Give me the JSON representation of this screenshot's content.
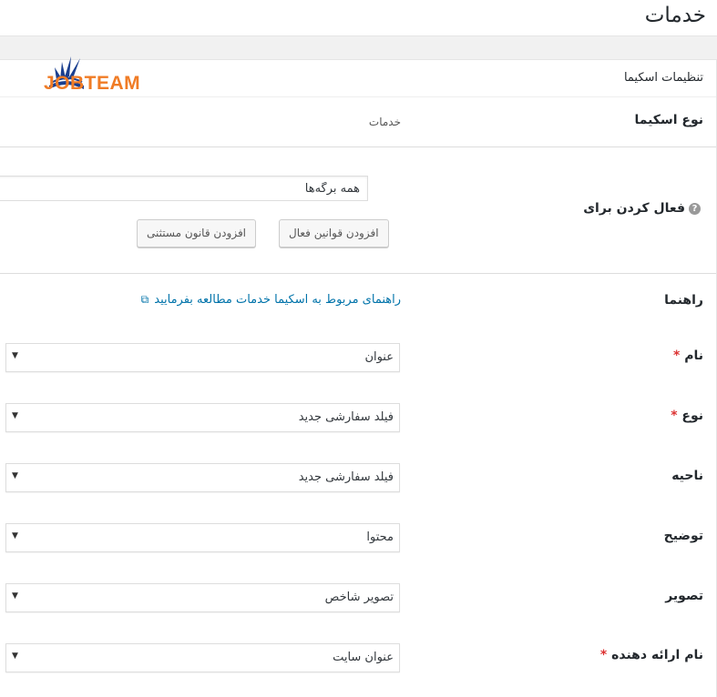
{
  "page": {
    "title": "خدمات"
  },
  "section": {
    "title": "تنظیمات اسکیما"
  },
  "logo": {
    "text": "JOBTEAM",
    "color": "#f07c26",
    "book_color": "#1a3f8f"
  },
  "schema_type": {
    "label": "نوع اسکیما",
    "value": "خدمات"
  },
  "enable_for": {
    "label": "فعال کردن برای",
    "help_icon": "question-circle-icon",
    "input_value": "همه برگه‌ها",
    "add_active_rules_button": "افزودن قوانین فعال",
    "add_exception_button": "افزودن قانون مستثنی"
  },
  "guide": {
    "label": "راهنما",
    "link_text": "راهنمای مربوط به اسکیما خدمات مطالعه بفرمایید",
    "link_icon": "external-link-icon"
  },
  "fields": [
    {
      "label": "نام",
      "required": "*",
      "value": "عنوان"
    },
    {
      "label": "نوع",
      "required": "*",
      "value": "فیلد سفارشی جدید"
    },
    {
      "label": "ناحیه",
      "required": "",
      "value": "فیلد سفارشی جدید"
    },
    {
      "label": "توضیح",
      "required": "",
      "value": "محتوا"
    },
    {
      "label": "تصویر",
      "required": "",
      "value": "تصویر شاخص"
    },
    {
      "label": "نام ارائه دهنده",
      "required": "*",
      "value": "عنوان سایت"
    }
  ],
  "colors": {
    "link": "#0073aa",
    "required": "#dc3232"
  }
}
